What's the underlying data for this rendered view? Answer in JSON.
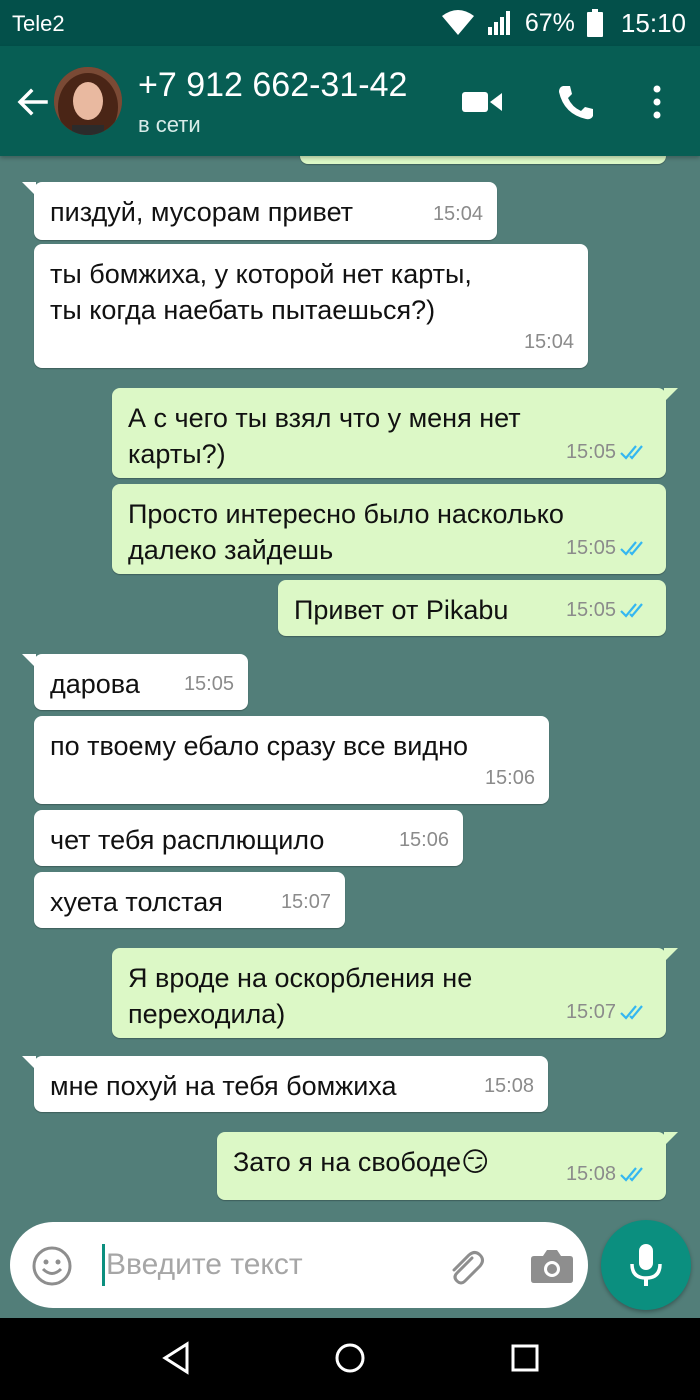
{
  "status": {
    "carrier": "Tele2",
    "battery": "67%",
    "time": "15:10"
  },
  "header": {
    "contact": "+7 912 662-31-42",
    "presence": "в сети"
  },
  "messages": [
    {
      "dir": "in",
      "text": "пиздуй, мусорам привет",
      "time": "15:04"
    },
    {
      "dir": "in",
      "text": "ты бомжиха, у которой нет карты,\nты когда наебать пытаешься?)",
      "time": "15:04"
    },
    {
      "dir": "out",
      "text": "А с чего ты взял что у меня нет\nкарты?)",
      "time": "15:05"
    },
    {
      "dir": "out",
      "text": "Просто интересно было насколько\nдалеко зайдешь",
      "time": "15:05"
    },
    {
      "dir": "out",
      "text": "Привет от Pikabu",
      "time": "15:05"
    },
    {
      "dir": "in",
      "text": "дарова",
      "time": "15:05"
    },
    {
      "dir": "in",
      "text": "по твоему ебало сразу все видно",
      "time": "15:06"
    },
    {
      "dir": "in",
      "text": "чет тебя расплющило",
      "time": "15:06"
    },
    {
      "dir": "in",
      "text": "хуета толстая",
      "time": "15:07"
    },
    {
      "dir": "out",
      "text": "Я вроде на оскорбления не\nпереходила)",
      "time": "15:07"
    },
    {
      "dir": "in",
      "text": "мне похуй на тебя бомжиха",
      "time": "15:08"
    },
    {
      "dir": "out",
      "text": "Зато я на свободе😏",
      "time": "15:08"
    }
  ],
  "composer": {
    "placeholder": "Введите текст"
  },
  "colors": {
    "statusbar": "#03504A",
    "appbar": "#075E54",
    "chat_bg": "#527E79",
    "incoming_bubble": "#FFFFFF",
    "outgoing_bubble": "#DCF8C6",
    "read_ticks": "#34B7F1",
    "accent": "#0B8F7F"
  },
  "icons": {
    "back": "arrow-left-icon",
    "video": "video-call-icon",
    "call": "phone-icon",
    "menu": "more-vert-icon",
    "emoji": "emoji-icon",
    "attach": "paperclip-icon",
    "camera": "camera-icon",
    "mic": "microphone-icon"
  }
}
